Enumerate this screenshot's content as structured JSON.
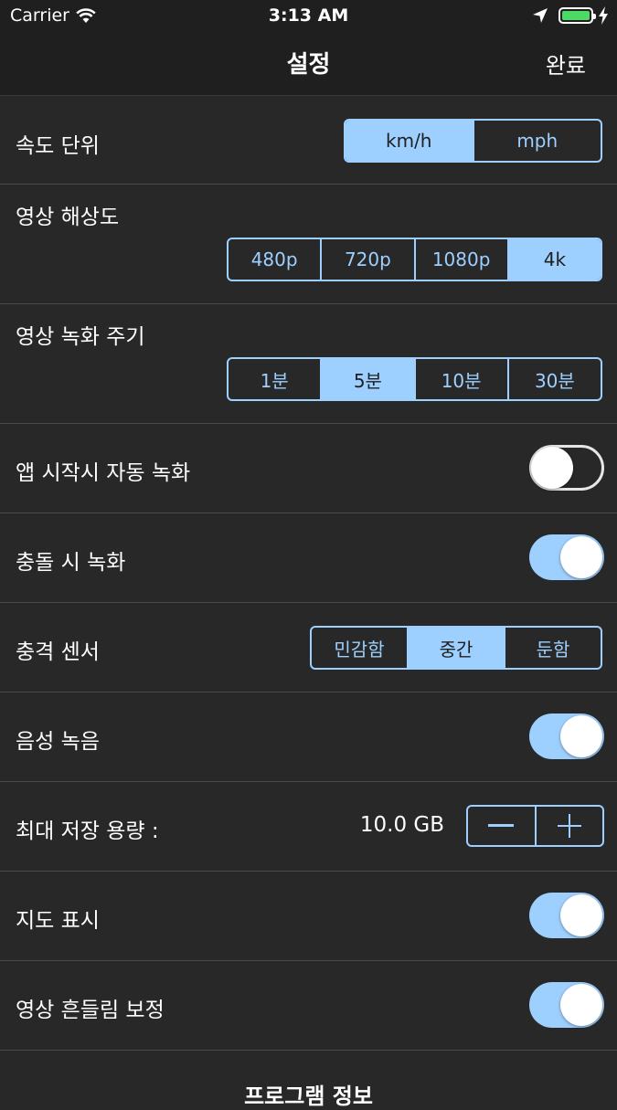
{
  "status_bar": {
    "carrier": "Carrier",
    "time": "3:13 AM"
  },
  "nav": {
    "title": "설정",
    "done_label": "완료"
  },
  "speed_unit": {
    "label": "속도 단위",
    "options": [
      "km/h",
      "mph"
    ],
    "selected": "km/h"
  },
  "video_resolution": {
    "label": "영상 해상도",
    "options": [
      "480p",
      "720p",
      "1080p",
      "4k"
    ],
    "selected": "4k"
  },
  "record_interval": {
    "label": "영상 녹화 주기",
    "options": [
      "1분",
      "5분",
      "10분",
      "30분"
    ],
    "selected": "5분"
  },
  "auto_record": {
    "label": "앱 시작시 자동 녹화",
    "on": false
  },
  "collision_record": {
    "label": "충돌 시 녹화",
    "on": true
  },
  "impact_sensor": {
    "label": "충격 센서",
    "options": [
      "민감함",
      "중간",
      "둔함"
    ],
    "selected": "중간"
  },
  "voice_record": {
    "label": "음성 녹음",
    "on": true
  },
  "max_storage": {
    "label": "최대 저장 용량 :",
    "value": "10.0 GB"
  },
  "map_display": {
    "label": "지도 표시",
    "on": true
  },
  "stabilization": {
    "label": "영상 흔들림 보정",
    "on": true
  },
  "program_info": {
    "label": "프로그램 정보"
  },
  "colors": {
    "accent": "#9dd0ff",
    "background": "#282828",
    "bar": "#1f1f1f",
    "battery": "#4cd964"
  }
}
